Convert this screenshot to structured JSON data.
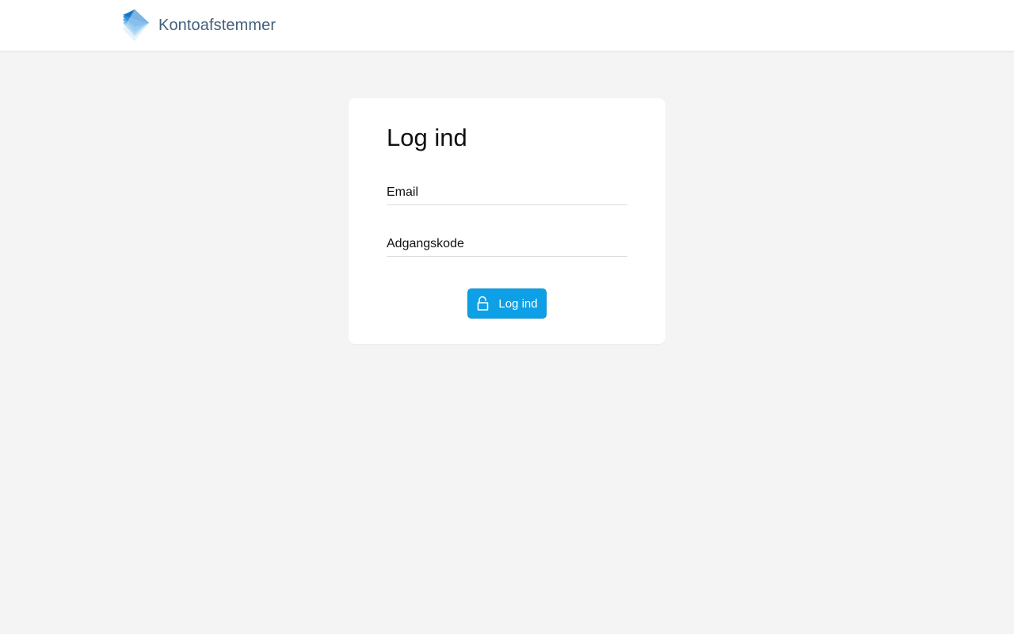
{
  "header": {
    "brand_name": "Kontoafstemmer",
    "logo_icon": "stacked-diamond-logo"
  },
  "login": {
    "title": "Log ind",
    "email": {
      "placeholder": "Email",
      "value": ""
    },
    "password": {
      "placeholder": "Adgangskode",
      "value": ""
    },
    "submit_label": "Log ind",
    "submit_icon": "unlock-icon"
  },
  "colors": {
    "background": "#f4f4f4",
    "card": "#ffffff",
    "accent": "#0ea0e6",
    "brand_text": "#44607c"
  }
}
